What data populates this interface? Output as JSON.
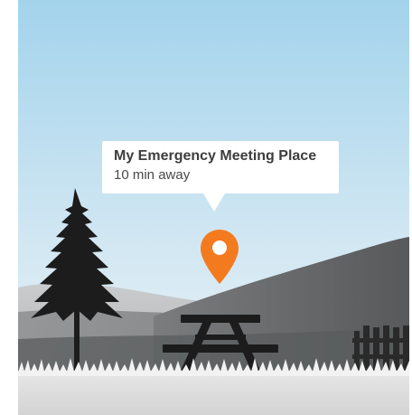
{
  "callout": {
    "title": "My Emergency Meeting Place",
    "subtitle": "10 min away"
  },
  "colors": {
    "sky_top": "#a7d5ec",
    "sky_bottom": "#e6f1f6",
    "pin": "#f47a20",
    "silhouette": "#1c1c1c",
    "ground": "#d9d9d9"
  },
  "icons": {
    "pin": "map-pin-icon",
    "tree": "pine-tree-icon",
    "table": "picnic-table-icon",
    "fence": "fence-icon"
  }
}
